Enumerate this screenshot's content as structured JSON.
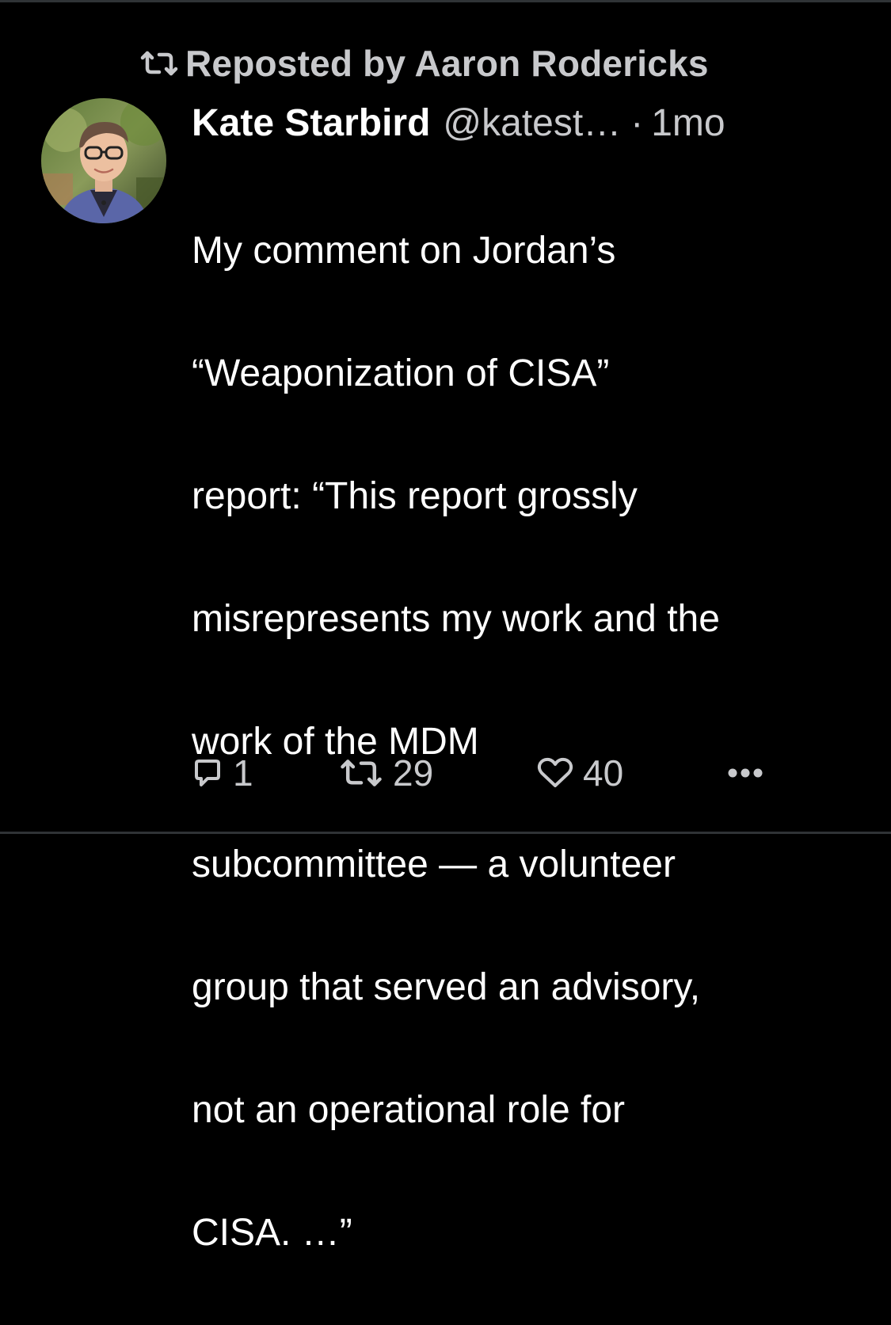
{
  "repost_banner": {
    "label": "Reposted by Aaron Rodericks"
  },
  "post": {
    "author": {
      "display_name": "Kate Starbird",
      "handle": "@katest…",
      "separator": "·",
      "time": "1mo"
    },
    "text_lines": [
      "My comment on Jordan’s",
      "“Weaponization of CISA”",
      "report: “This report grossly",
      "misrepresents my work and the",
      "work of the MDM",
      "subcommittee — a volunteer",
      "group that served an advisory,",
      "not an operational role for",
      "CISA. …”"
    ]
  },
  "actions": {
    "reply_count": "1",
    "repost_count": "29",
    "like_count": "40",
    "reply_icon": "speech-bubble-icon",
    "repost_icon": "repost-arrows-icon",
    "like_icon": "heart-outline-icon",
    "more_icon": "ellipsis-icon"
  },
  "colors": {
    "background": "#000000",
    "primary_text": "#ffffff",
    "secondary_text": "#c8c9cc",
    "divider": "#2f3336"
  }
}
